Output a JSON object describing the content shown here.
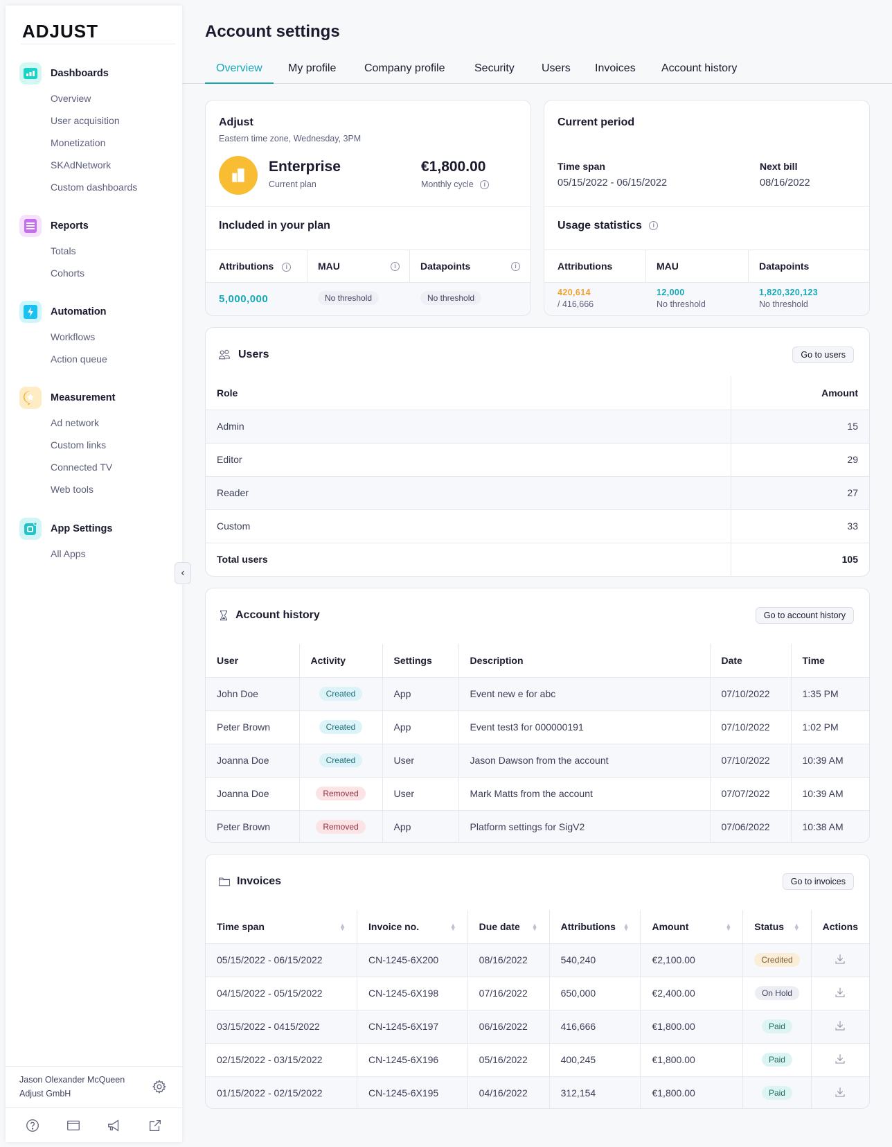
{
  "sidebar": {
    "logo": "ADJUST",
    "groups": [
      {
        "title": "Dashboards",
        "icon": "dashboards-icon",
        "color": "#19d3c5",
        "bg": "#d3f8f4",
        "items": [
          "Overview",
          "User acquisition",
          "Monetization",
          "SKAdNetwork",
          "Custom dashboards"
        ]
      },
      {
        "title": "Reports",
        "icon": "reports-icon",
        "color": "#c56ef0",
        "bg": "#f6e1fc",
        "items": [
          "Totals",
          "Cohorts"
        ]
      },
      {
        "title": "Automation",
        "icon": "automation-icon",
        "color": "#19c0f0",
        "bg": "#cdf6fc",
        "items": [
          "Workflows",
          "Action queue"
        ]
      },
      {
        "title": "Measurement",
        "icon": "measurement-icon",
        "color": "#f6a821",
        "bg": "#fdecc4",
        "items": [
          "Ad network",
          "Custom links",
          "Connected TV",
          "Web tools"
        ]
      },
      {
        "title": "App Settings",
        "icon": "app-settings-icon",
        "color": "#23c3c8",
        "bg": "#cff5f7",
        "items": [
          "All Apps"
        ]
      }
    ],
    "user_name": "Jason Olexander McQueen",
    "user_org": "Adjust GmbH"
  },
  "header": {
    "title": "Account settings",
    "tabs": [
      "Overview",
      "My profile",
      "Company profile",
      "Security",
      "Users",
      "Invoices",
      "Account history"
    ],
    "active_tab": "Overview"
  },
  "plan": {
    "company": "Adjust",
    "timezone": "Eastern time zone, Wednesday, 3PM",
    "plan_name": "Enterprise",
    "plan_label": "Current plan",
    "price": "€1,800.00",
    "cycle": "Monthly cycle",
    "included_title": "Included in your plan",
    "cols": [
      "Attributions",
      "MAU",
      "Datapoints"
    ],
    "attributions": "5,000,000",
    "mau": "No threshold",
    "datapoints": "No threshold"
  },
  "period": {
    "title": "Current period",
    "timespan_label": "Time span",
    "timespan": "05/15/2022 - 06/15/2022",
    "nextbill_label": "Next bill",
    "nextbill": "08/16/2022",
    "usage_title": "Usage statistics",
    "cols": [
      "Attributions",
      "MAU",
      "Datapoints"
    ],
    "attributions": "420,614",
    "attributions_sub": "/ 416,666",
    "mau": "12,000",
    "mau_sub": "No threshold",
    "datapoints": "1,820,320,123",
    "datapoints_sub": "No threshold",
    "over_color": "#f0a030",
    "ok_color": "#14a7b8"
  },
  "users": {
    "title": "Users",
    "button": "Go to users",
    "headers": [
      "Role",
      "Amount"
    ],
    "rows": [
      [
        "Admin",
        "15"
      ],
      [
        "Editor",
        "29"
      ],
      [
        "Reader",
        "27"
      ],
      [
        "Custom",
        "33"
      ]
    ],
    "total_label": "Total users",
    "total": "105"
  },
  "history": {
    "title": "Account history",
    "button": "Go to account history",
    "headers": [
      "User",
      "Activity",
      "Settings",
      "Description",
      "Date",
      "Time"
    ],
    "rows": [
      [
        "John Doe",
        "Created",
        "App",
        "Event new e for abc",
        "07/10/2022",
        "1:35 PM"
      ],
      [
        "Peter Brown",
        "Created",
        "App",
        "Event test3 for 000000191",
        "07/10/2022",
        "1:02 PM"
      ],
      [
        "Joanna Doe",
        "Created",
        "User",
        "Jason Dawson from the account",
        "07/10/2022",
        "10:39 AM"
      ],
      [
        "Joanna Doe",
        "Removed",
        "User",
        "Mark Matts from the account",
        "07/07/2022",
        "10:39 AM"
      ],
      [
        "Peter Brown",
        "Removed",
        "App",
        "Platform settings for SigV2",
        "07/06/2022",
        "10:38 AM"
      ]
    ]
  },
  "invoices": {
    "title": "Invoices",
    "button": "Go to invoices",
    "headers": [
      "Time span",
      "Invoice no.",
      "Due date",
      "Attributions",
      "Amount",
      "Status",
      "Actions"
    ],
    "rows": [
      [
        "05/15/2022 - 06/15/2022",
        "CN-1245-6X200",
        "08/16/2022",
        "540,240",
        "€2,100.00",
        "Credited"
      ],
      [
        "04/15/2022 - 05/15/2022",
        "CN-1245-6X198",
        "07/16/2022",
        "650,000",
        "€2,400.00",
        "On Hold"
      ],
      [
        "03/15/2022 - 0415/2022",
        "CN-1245-6X197",
        "06/16/2022",
        "416,666",
        "€1,800.00",
        "Paid"
      ],
      [
        "02/15/2022 - 03/15/2022",
        "CN-1245-6X196",
        "05/16/2022",
        "400,245",
        "€1,800.00",
        "Paid"
      ],
      [
        "01/15/2022 - 02/15/2022",
        "CN-1245-6X195",
        "04/16/2022",
        "312,154",
        "€1,800.00",
        "Paid"
      ]
    ]
  }
}
